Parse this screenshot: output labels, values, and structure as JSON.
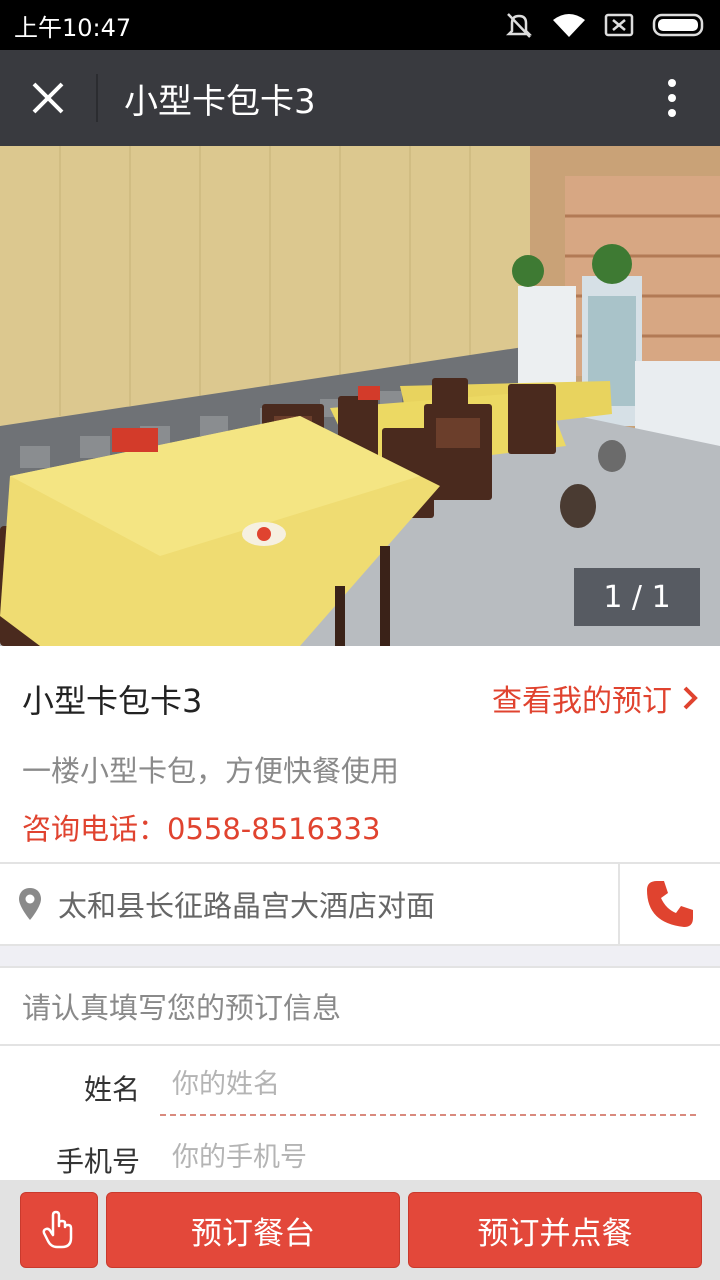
{
  "status_bar": {
    "time": "上午10:47",
    "icons": [
      "mute-icon",
      "wifi-icon",
      "sim-icon",
      "battery-icon"
    ]
  },
  "nav": {
    "title": "小型卡包卡3",
    "close_icon": "close-icon",
    "more_icon": "more-vertical-icon"
  },
  "gallery": {
    "counter": "1 / 1"
  },
  "room": {
    "title": "小型卡包卡3",
    "my_booking_link": "查看我的预订",
    "description": "一楼小型卡包，方便快餐使用",
    "phone_text": "咨询电话：0558-8516333"
  },
  "address": {
    "text": "太和县长征路晶宫大酒店对面",
    "pin_icon": "location-pin-icon",
    "call_icon": "phone-icon"
  },
  "form": {
    "header": "请认真填写您的预订信息",
    "name_label": "姓名",
    "name_placeholder": "你的姓名",
    "phone_label": "手机号",
    "phone_placeholder": "你的手机号"
  },
  "actions": {
    "hand_icon": "hand-pointer-icon",
    "book_table": "预订餐台",
    "book_and_order": "预订并点餐"
  },
  "colors": {
    "accent": "#e3483a",
    "nav_bg": "#393a3f",
    "link_red": "#e0432f"
  }
}
